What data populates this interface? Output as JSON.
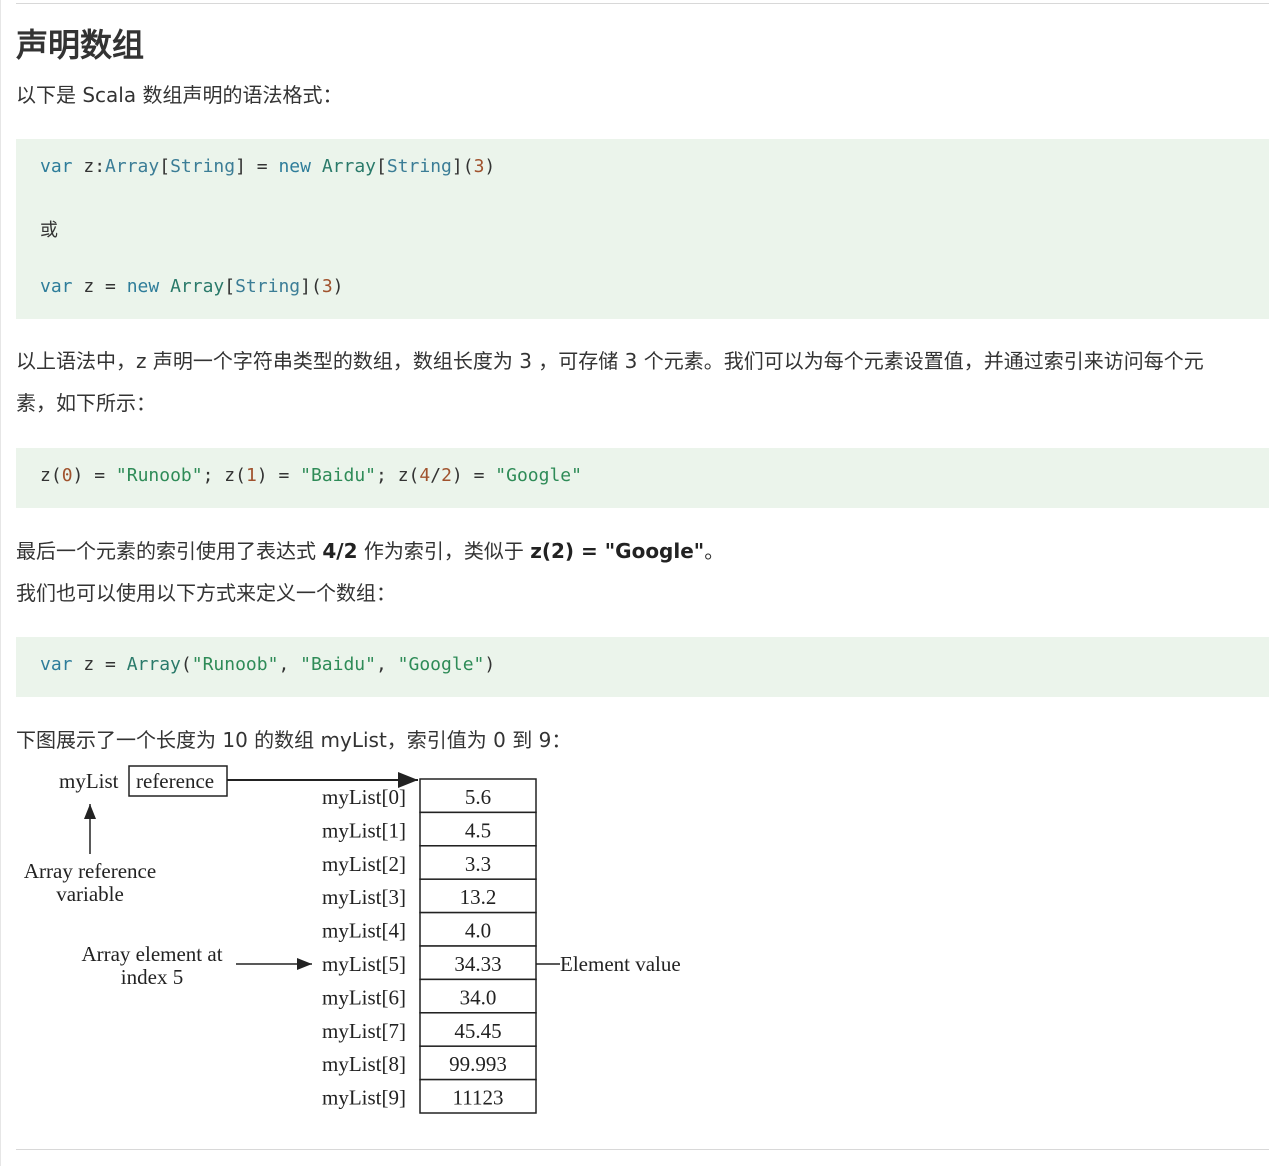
{
  "heading": "声明数组",
  "intro": "以下是 Scala 数组声明的语法格式：",
  "code1": {
    "line1": {
      "kw1": "var",
      "name": " z:",
      "t1": "Array",
      "b1": "[",
      "t2": "String",
      "b2": "]",
      "eq": " = ",
      "kw2": "new",
      "sp": " ",
      "t3": "Array",
      "b3": "[",
      "t4": "String",
      "b4": "](",
      "n": "3",
      "end": ")"
    },
    "line2": "或",
    "line3": {
      "kw1": "var",
      "name": " z = ",
      "kw2": "new",
      "sp": " ",
      "t1": "Array",
      "b1": "[",
      "t2": "String",
      "b2": "](",
      "n": "3",
      "end": ")"
    }
  },
  "para2_line1": "以上语法中，z 声明一个字符串类型的数组，数组长度为 3 ，可存储 3 个元素。我们可以为每个元素设置值，并通过索引来访问每个元",
  "para2_line2": "素，如下所示：",
  "code2": {
    "a": "z(",
    "n0": "0",
    "b": ") = ",
    "s1": "\"Runoob\"",
    "c": "; z(",
    "n1": "1",
    "d": ") = ",
    "s2": "\"Baidu\"",
    "e": "; z(",
    "n4": "4",
    "slash": "/",
    "n2": "2",
    "f": ") = ",
    "s3": "\"Google\""
  },
  "para3": {
    "pre": "最后一个元素的索引使用了表达式 ",
    "bold1": "4/2",
    "mid": " 作为索引，类似于 ",
    "bold2": "z(2) = \"Google\"",
    "post": "。"
  },
  "para4": "我们也可以使用以下方式来定义一个数组：",
  "code3": {
    "kw": "var",
    "name": " z = ",
    "t": "Array",
    "open": "(",
    "s1": "\"Runoob\"",
    "c1": ", ",
    "s2": "\"Baidu\"",
    "c2": ", ",
    "s3": "\"Google\"",
    "close": ")"
  },
  "para5": "下图展示了一个长度为 10 的数组 myList，索引值为 0 到 9：",
  "diagram": {
    "var_label": "myList",
    "ref_box": "reference",
    "ref_caption_1": "Array reference",
    "ref_caption_2": "variable",
    "elem_caption_1": "Array element at",
    "elem_caption_2": "index 5",
    "value_caption": "Element value",
    "indices": [
      "myList[0]",
      "myList[1]",
      "myList[2]",
      "myList[3]",
      "myList[4]",
      "myList[5]",
      "myList[6]",
      "myList[7]",
      "myList[8]",
      "myList[9]"
    ],
    "values": [
      "5.6",
      "4.5",
      "3.3",
      "13.2",
      "4.0",
      "34.33",
      "34.0",
      "45.45",
      "99.993",
      "11123"
    ]
  }
}
